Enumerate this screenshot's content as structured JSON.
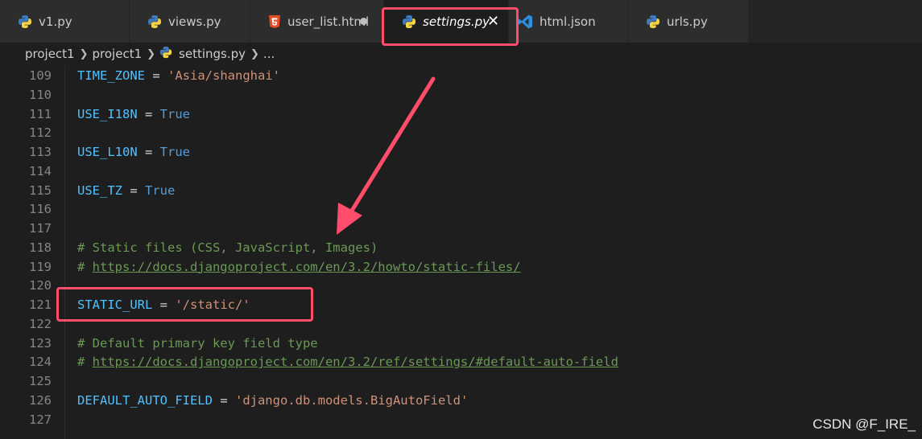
{
  "tabs": [
    {
      "label": "v1.py",
      "icon": "python-icon"
    },
    {
      "label": "views.py",
      "icon": "python-icon"
    },
    {
      "label": "user_list.html",
      "icon": "html5-icon",
      "modified": true
    },
    {
      "label": "settings.py",
      "icon": "python-icon",
      "active": true
    },
    {
      "label": "html.json",
      "icon": "vscode-icon"
    },
    {
      "label": "urls.py",
      "icon": "python-icon"
    }
  ],
  "breadcrumb": {
    "items": [
      "project1",
      "project1",
      "settings.py",
      "..."
    ]
  },
  "editor": {
    "lines": [
      {
        "num": "109",
        "tokens": [
          [
            "TIME_ZONE",
            "var"
          ],
          [
            " = ",
            "op"
          ],
          [
            "'Asia/shanghai'",
            "str"
          ]
        ]
      },
      {
        "num": "110",
        "tokens": []
      },
      {
        "num": "111",
        "tokens": [
          [
            "USE_I18N",
            "var"
          ],
          [
            " = ",
            "op"
          ],
          [
            "True",
            "kw"
          ]
        ]
      },
      {
        "num": "112",
        "tokens": []
      },
      {
        "num": "113",
        "tokens": [
          [
            "USE_L10N",
            "var"
          ],
          [
            " = ",
            "op"
          ],
          [
            "True",
            "kw"
          ]
        ]
      },
      {
        "num": "114",
        "tokens": []
      },
      {
        "num": "115",
        "tokens": [
          [
            "USE_TZ",
            "var"
          ],
          [
            " = ",
            "op"
          ],
          [
            "True",
            "kw"
          ]
        ]
      },
      {
        "num": "116",
        "tokens": []
      },
      {
        "num": "117",
        "tokens": []
      },
      {
        "num": "118",
        "tokens": [
          [
            "# Static files (CSS, JavaScript, Images)",
            "comment"
          ]
        ]
      },
      {
        "num": "119",
        "tokens": [
          [
            "# ",
            "comment"
          ],
          [
            "https://docs.djangoproject.com/en/3.2/howto/static-files/",
            "link"
          ]
        ]
      },
      {
        "num": "120",
        "tokens": []
      },
      {
        "num": "121",
        "tokens": [
          [
            "STATIC_URL",
            "var"
          ],
          [
            " = ",
            "op"
          ],
          [
            "'/static/'",
            "str"
          ]
        ]
      },
      {
        "num": "122",
        "tokens": []
      },
      {
        "num": "123",
        "tokens": [
          [
            "# Default primary key field type",
            "comment"
          ]
        ]
      },
      {
        "num": "124",
        "tokens": [
          [
            "# ",
            "comment"
          ],
          [
            "https://docs.djangoproject.com/en/3.2/ref/settings/#default-auto-field",
            "link"
          ]
        ]
      },
      {
        "num": "125",
        "tokens": []
      },
      {
        "num": "126",
        "tokens": [
          [
            "DEFAULT_AUTO_FIELD",
            "var"
          ],
          [
            " = ",
            "op"
          ],
          [
            "'django.db.models.BigAutoField'",
            "str"
          ]
        ]
      },
      {
        "num": "127",
        "tokens": []
      }
    ]
  },
  "watermark": "CSDN @F_IRE_",
  "colors": {
    "annotation": "#ff4d6b",
    "variable": "#4fc1ff",
    "string": "#ce9178",
    "keyword": "#569cd6",
    "comment": "#6a9955"
  }
}
